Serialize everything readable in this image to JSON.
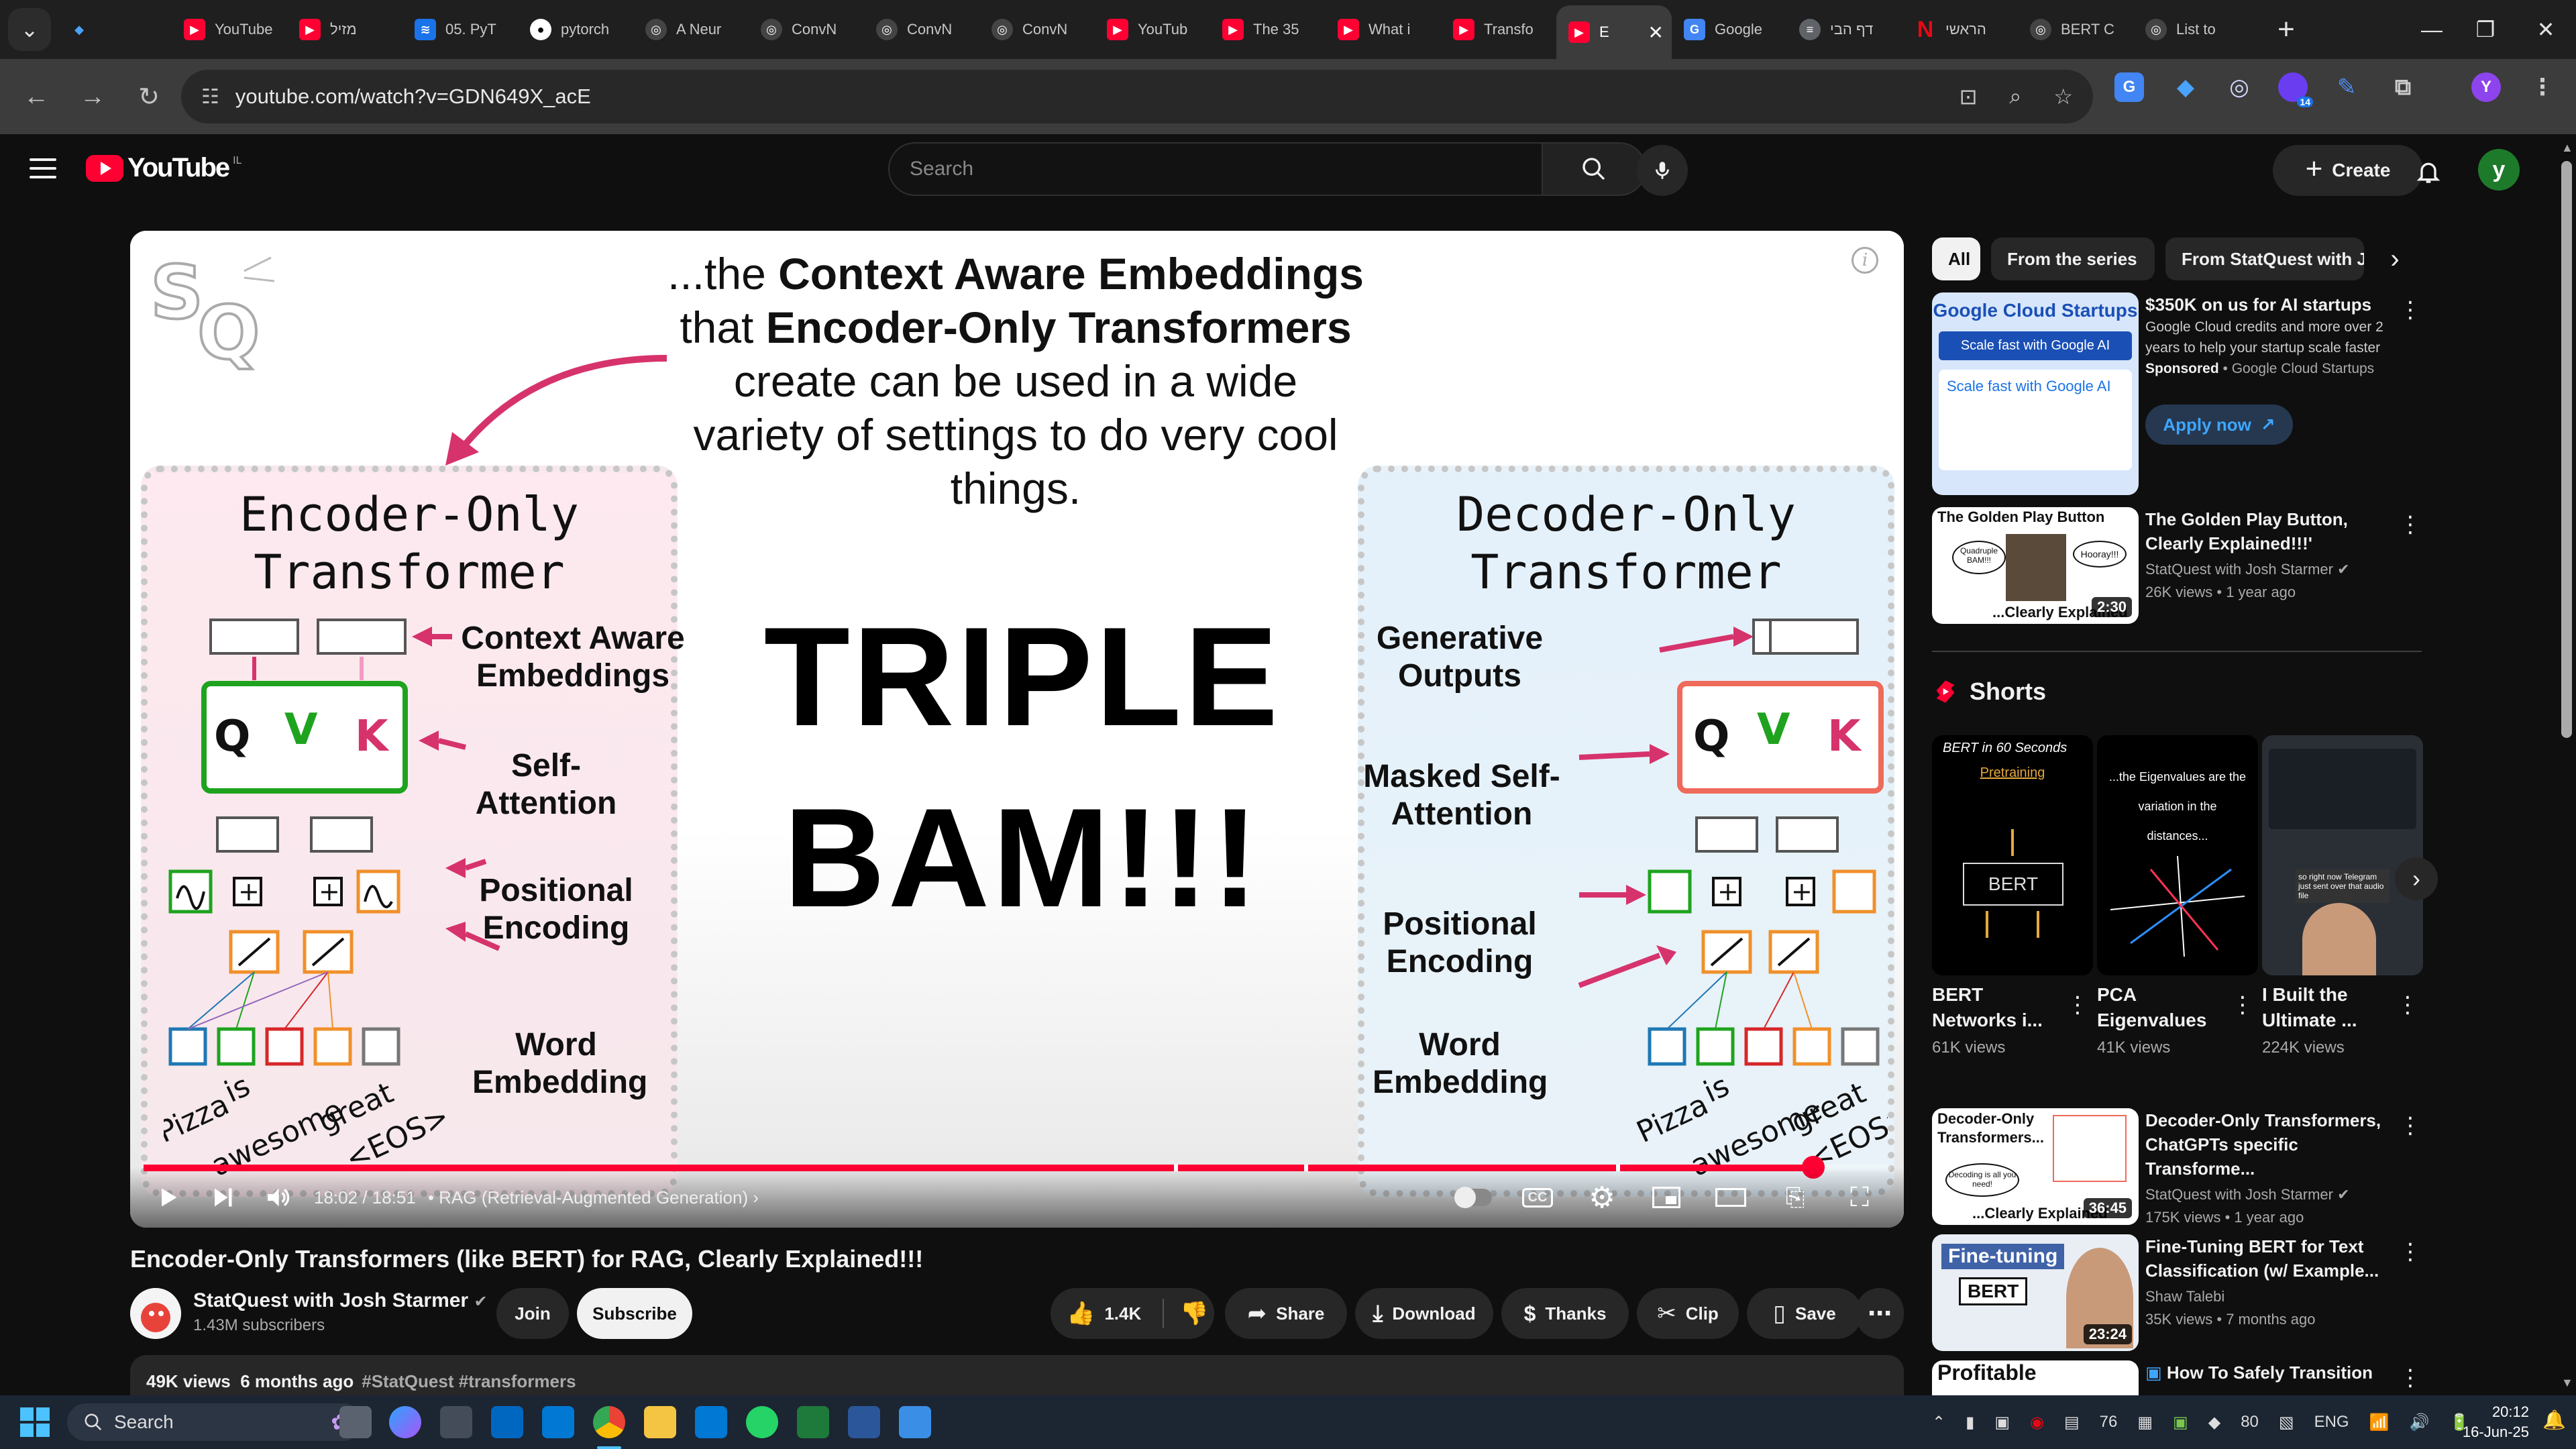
{
  "browser": {
    "tabs": [
      {
        "title": "",
        "icon": "gem-icon"
      },
      {
        "title": "YouTube",
        "icon": "youtube-icon"
      },
      {
        "title": "מזיל",
        "icon": "youtube-icon"
      },
      {
        "title": "05. PyT",
        "icon": "layers-icon"
      },
      {
        "title": "pytorch",
        "icon": "github-icon"
      },
      {
        "title": "A Neur",
        "icon": "openai-icon"
      },
      {
        "title": "ConvN",
        "icon": "openai-icon"
      },
      {
        "title": "ConvN",
        "icon": "openai-icon"
      },
      {
        "title": "ConvN",
        "icon": "openai-icon"
      },
      {
        "title": "YouTub",
        "icon": "youtube-icon"
      },
      {
        "title": "The 35",
        "icon": "youtube-icon"
      },
      {
        "title": "What i",
        "icon": "youtube-icon"
      },
      {
        "title": "Transfo",
        "icon": "youtube-icon"
      },
      {
        "title": "E",
        "icon": "youtube-icon",
        "active": true
      },
      {
        "title": "Google",
        "icon": "translate-icon"
      },
      {
        "title": "דף הבי",
        "icon": "site-icon"
      },
      {
        "title": "הראשי",
        "icon": "netflix-icon"
      },
      {
        "title": "BERT C",
        "icon": "openai-icon"
      },
      {
        "title": "List to",
        "icon": "openai-icon"
      }
    ],
    "url": "youtube.com/watch?v=GDN649X_acE",
    "profile_initial": "Y",
    "extension_badge": "14"
  },
  "youtube": {
    "logo_text": "YouTube",
    "country_code": "IL",
    "search_placeholder": "Search",
    "create_label": "Create",
    "avatar_initial": "y"
  },
  "video": {
    "slide": {
      "headline_parts": [
        "...the ",
        "Context Aware Embeddings",
        " that ",
        "Encoder-Only Transformers",
        " create can be used in a wide variety of settings to do very cool things."
      ],
      "encoder_title": "Encoder-Only Transformer",
      "decoder_title": "Decoder-Only Transformer",
      "bam_line1": "TRIPLE",
      "bam_line2": "BAM!!!",
      "enc_labels": {
        "cae": "Context Aware Embeddings",
        "sa": "Self-Attention",
        "pe": "Positional Encoding",
        "we": "Word Embedding"
      },
      "dec_labels": {
        "go": "Generative Outputs",
        "msa": "Masked Self-Attention",
        "pe": "Positional Encoding",
        "we": "Word Embedding"
      },
      "qvk": [
        "Q",
        "V",
        "K"
      ],
      "tokens": [
        "Pizza",
        "is",
        "awesome",
        "great",
        "<EOS>"
      ]
    },
    "time_current": "18:02",
    "time_total": "18:51",
    "time_sep": " / ",
    "chapter": "RAG (Retrieval-Augmented Generation)",
    "progress": 0.956,
    "title": "Encoder-Only Transformers (like BERT) for RAG, Clearly Explained!!!",
    "channel": "StatQuest with Josh Starmer",
    "subscribers": "1.43M subscribers",
    "join_label": "Join",
    "subscribe_label": "Subscribe",
    "likes": "1.4K",
    "share_label": "Share",
    "download_label": "Download",
    "thanks_label": "Thanks",
    "clip_label": "Clip",
    "save_label": "Save",
    "views": "49K views",
    "age": "6 months ago",
    "tags": "#StatQuest #transformers"
  },
  "sidebar": {
    "chips": [
      "All",
      "From the series",
      "From StatQuest with Josh"
    ],
    "ad": {
      "title": "$350K on us for AI startups",
      "desc": "Google Cloud credits and more over 2 years to help your startup scale faster",
      "sponsored": "Sponsored",
      "advertiser": "Google Cloud Startups",
      "cta": "Apply now",
      "thumb_title": "Google Cloud Startups",
      "thumb_banner": "Scale fast with Google AI",
      "thumb_sub": "Scale fast with Google AI"
    },
    "rec1": {
      "title": "The Golden Play Button, The Golden Play Button, Clearly Explained!!!'",
      "title_short": "The Golden Play Button, Clearly Explained!!!'",
      "channel": "StatQuest with Josh Starmer",
      "meta": "26K views • 1 year ago",
      "duration": "2:30",
      "thumb_title": "The Golden Play Button",
      "thumb_foot": "...Clearly Explained",
      "bubble1": "Quadruple BAM!!!",
      "bubble2": "Hooray!!!"
    },
    "shorts_label": "Shorts",
    "shorts": [
      {
        "title": "BERT Networks i...",
        "views": "61K views",
        "thumb_top": "BERT in 60 Seconds",
        "thumb_sub": "Pretraining",
        "thumb_box": "BERT"
      },
      {
        "title": "PCA Eigenvalues",
        "views": "41K views",
        "thumb_top": "...the Eigenvalues are the variation in the distances..."
      },
      {
        "title": "I Built the Ultimate ...",
        "views": "224K views",
        "thumb_top": "so right now Telegram just sent over that audio file"
      }
    ],
    "rec2": {
      "title": "Decoder-Only Transformers, ChatGPTs specific Transforme...",
      "channel": "StatQuest with Josh Starmer",
      "meta": "175K views • 1 year ago",
      "duration": "36:45",
      "thumb_title": "Decoder-Only Transformers...",
      "thumb_foot": "...Clearly Explained",
      "bubble": "Decoding is all you need!"
    },
    "rec3": {
      "title": "Fine-Tuning BERT for Text Classification (w/ Example...",
      "channel": "Shaw Talebi",
      "meta": "35K views • 7 months ago",
      "duration": "23:24",
      "thumb_title": "Fine-tuning",
      "thumb_box": "BERT"
    },
    "rec4": {
      "title": "How To Safely Transition",
      "thumb_title": "Profitable"
    }
  },
  "taskbar": {
    "search_label": "Search",
    "lang": "ENG",
    "time": "20:12",
    "date": "16-Jun-25",
    "temp": "76",
    "volume_badge": "80"
  },
  "colors": {
    "youtube_red": "#ff0033",
    "encoder_pink": "#d6336c",
    "green": "#1fa31f",
    "orange": "#f0902a",
    "decoder_salmon": "#ef6a5a",
    "link_blue": "#3ea6ff"
  }
}
